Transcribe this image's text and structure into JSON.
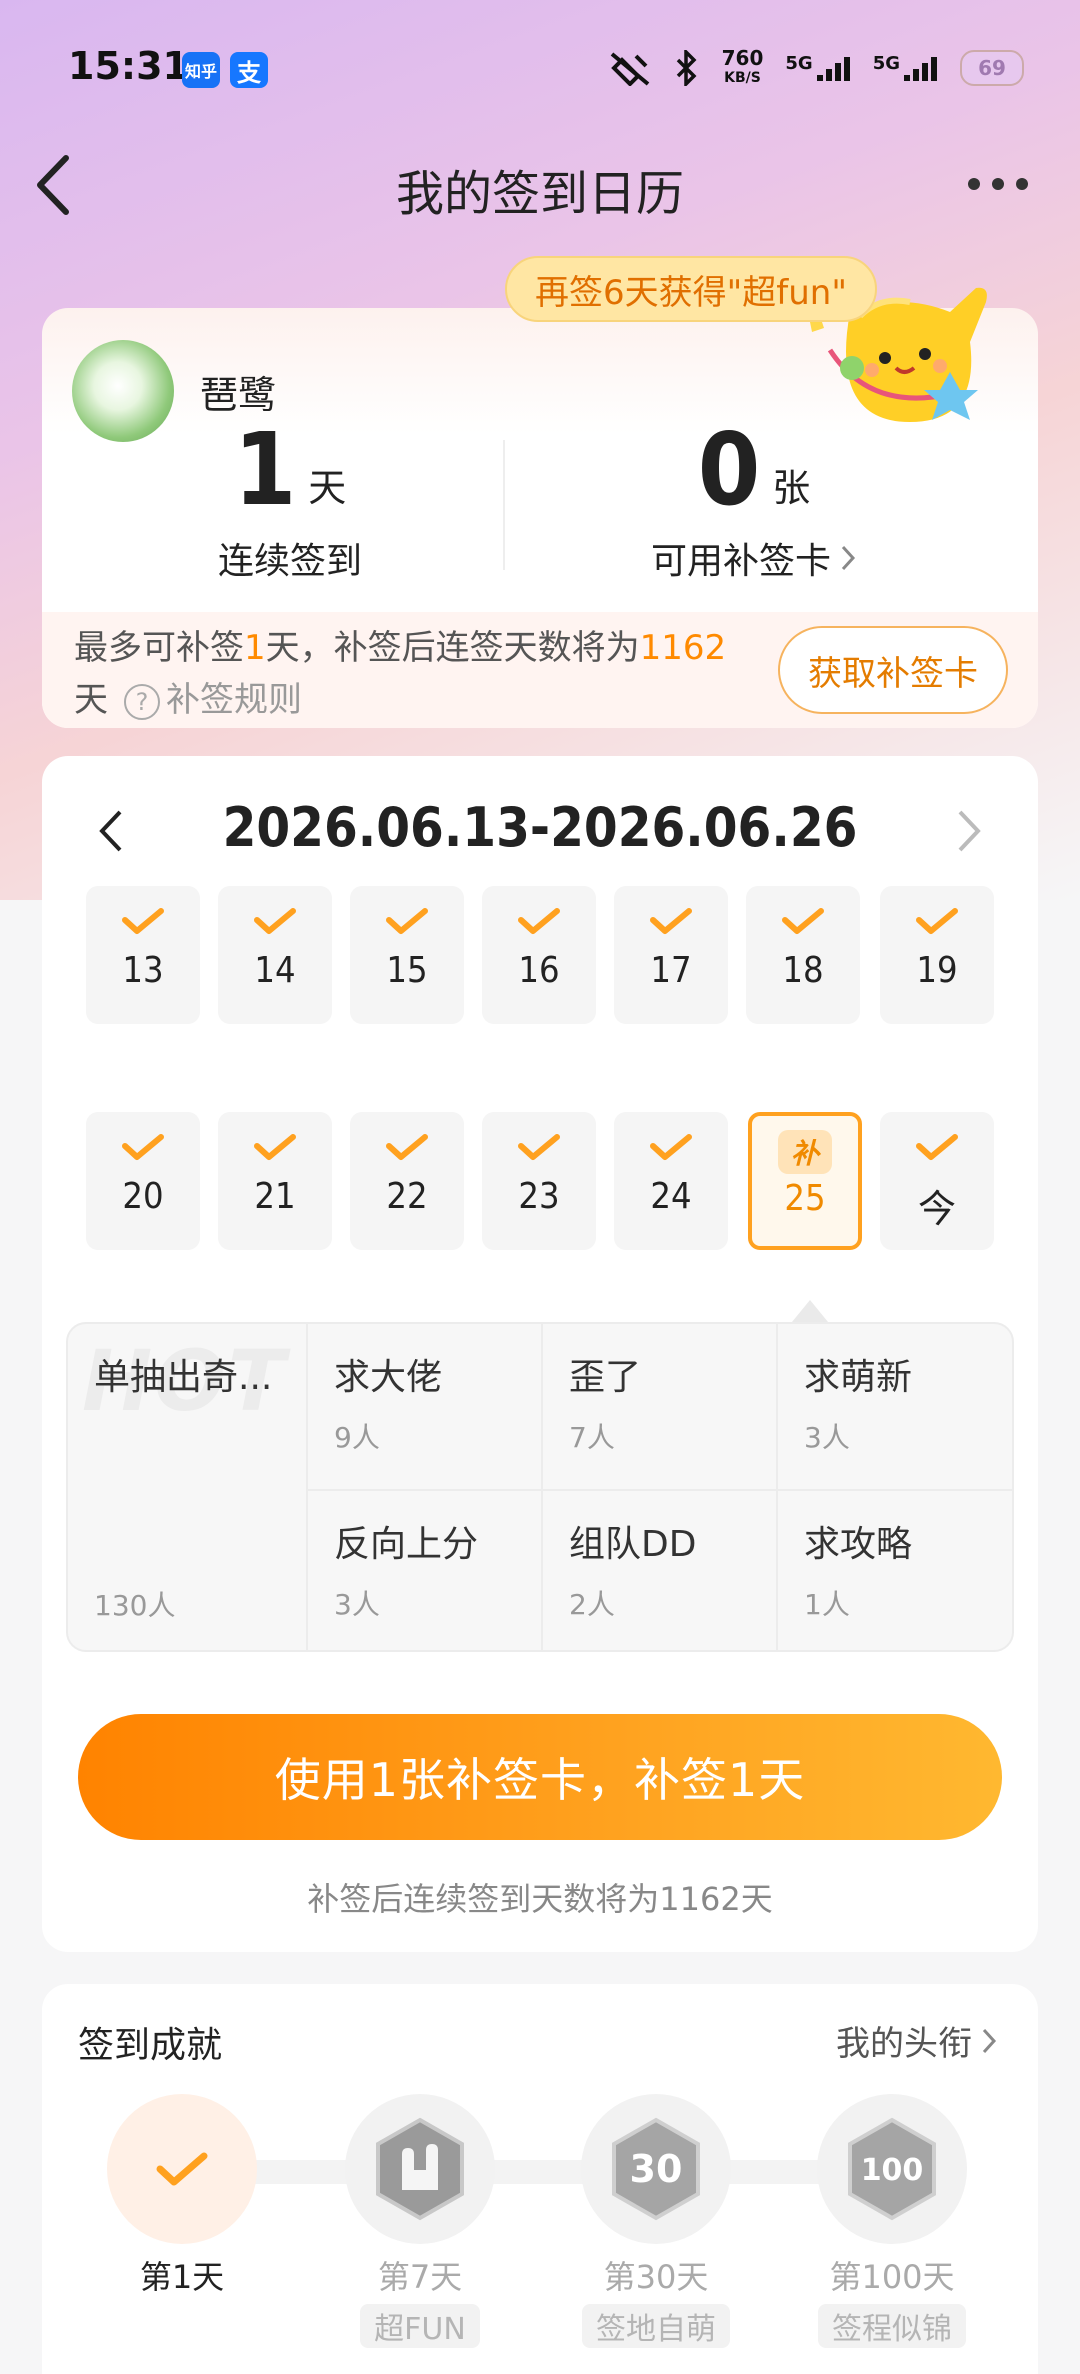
{
  "status_bar": {
    "time": "15:31",
    "apps": [
      "知乎",
      "支"
    ],
    "speed_value": "760",
    "speed_unit": "KB/S",
    "signal1": "5G",
    "signal2": "5G",
    "battery": "69"
  },
  "header": {
    "title": "我的签到日历"
  },
  "promo": {
    "bubble": "再签6天获得\"超fun\""
  },
  "user": {
    "name": "琶鹭"
  },
  "stats": {
    "streak_value": "1",
    "streak_unit": "天",
    "streak_label": "连续签到",
    "cards_value": "0",
    "cards_unit": "张",
    "cards_label": "可用补签卡"
  },
  "makeup_info": {
    "part1": "最多可补签",
    "days": "1",
    "part2": "天，补签后连签天数将为",
    "total": "1162",
    "part3": "天",
    "rules": "补签规则",
    "get_card_button": "获取补签卡"
  },
  "calendar": {
    "range": "2026.06.13-2026.06.26",
    "week1": [
      "13",
      "14",
      "15",
      "16",
      "17",
      "18",
      "19"
    ],
    "week2": [
      "20",
      "21",
      "22",
      "23",
      "24"
    ],
    "makeup_tag": "补",
    "makeup_day": "25",
    "today_label": "今"
  },
  "topics": {
    "hot_watermark": "HOT",
    "featured": {
      "name": "单抽出奇...",
      "count": "130人"
    },
    "items": [
      {
        "name": "求大佬",
        "count": "9人"
      },
      {
        "name": "歪了",
        "count": "7人"
      },
      {
        "name": "求萌新",
        "count": "3人"
      },
      {
        "name": "反向上分",
        "count": "3人"
      },
      {
        "name": "组队DD",
        "count": "2人"
      },
      {
        "name": "求攻略",
        "count": "1人"
      }
    ]
  },
  "cta": {
    "button": "使用1张补签卡，补签1天",
    "subtitle": "补签后连续签到天数将为1162天"
  },
  "achievements": {
    "title": "签到成就",
    "link": "我的头衔",
    "items": [
      {
        "label": "第1天",
        "tag": "",
        "icon": "check-icon"
      },
      {
        "label": "第7天",
        "tag": "超FUN",
        "icon": "rock-hand-badge-icon"
      },
      {
        "label": "第30天",
        "tag": "签地自萌",
        "icon": "30-days-badge-icon"
      },
      {
        "label": "第100天",
        "tag": "签程似锦",
        "icon": "100-days-badge-icon"
      }
    ]
  },
  "colors": {
    "accent": "#FF8A00",
    "check": "#FFA11F"
  }
}
